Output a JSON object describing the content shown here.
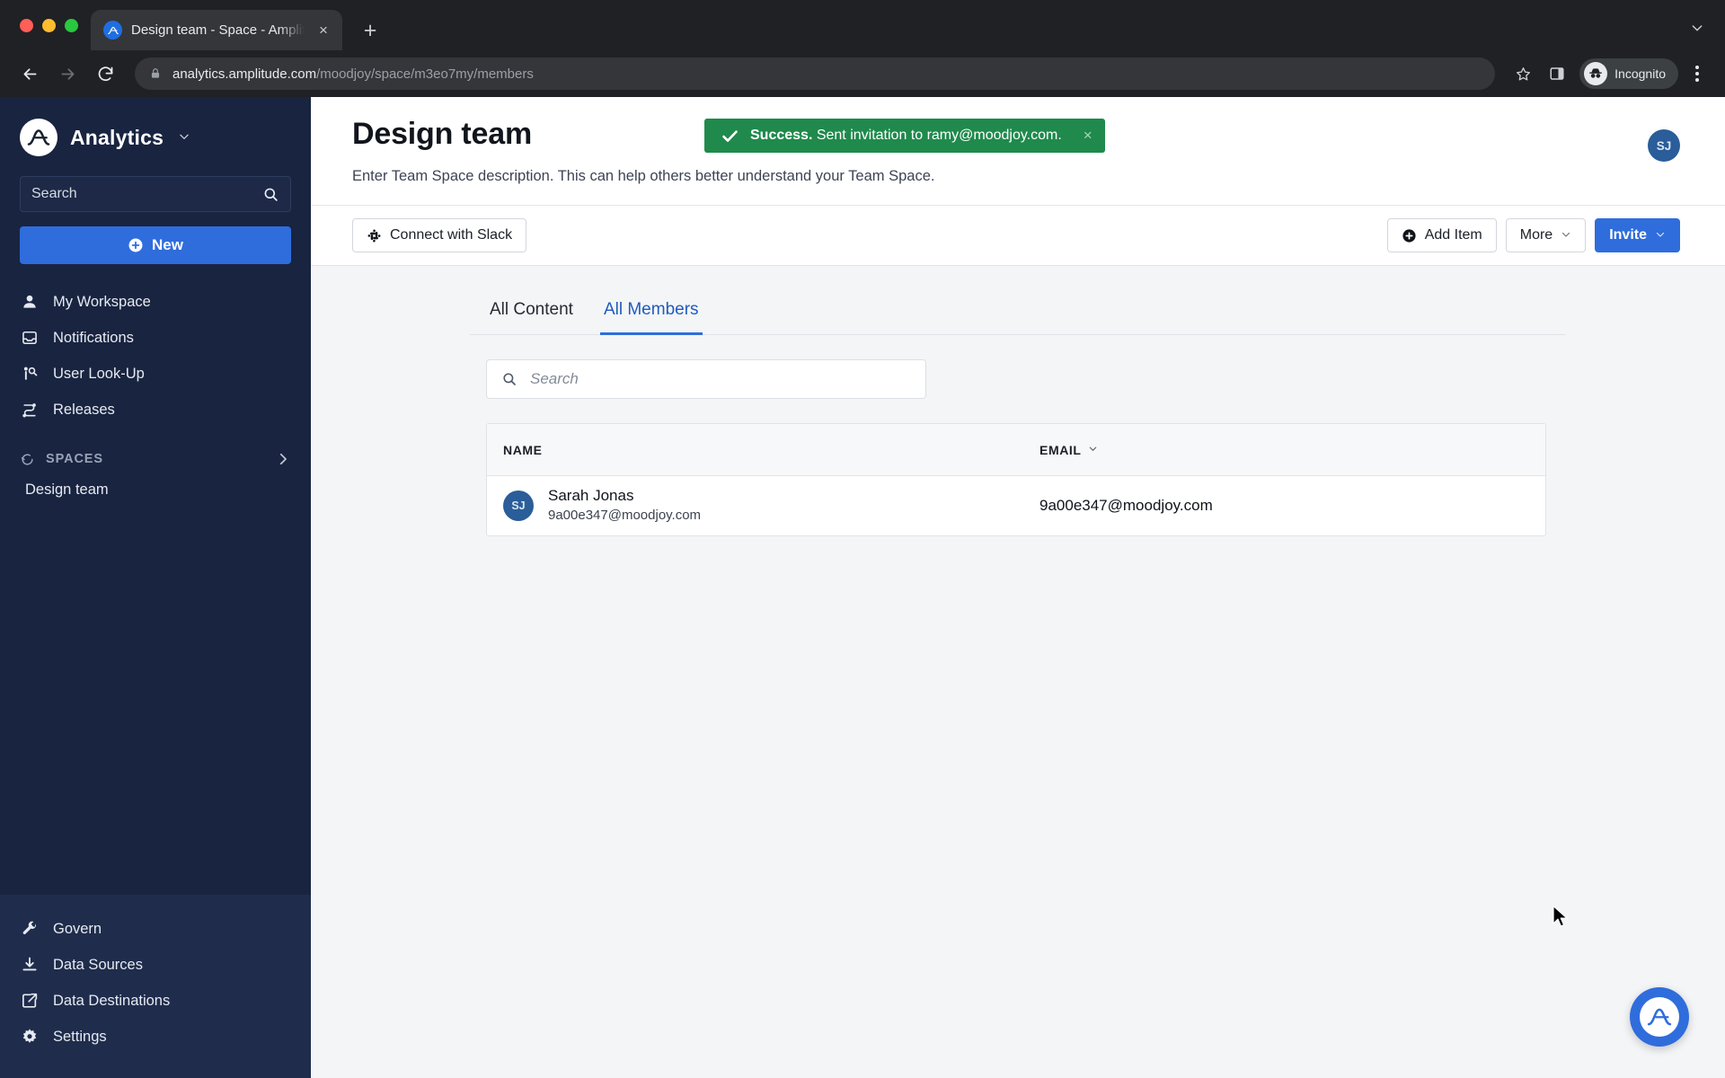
{
  "browser": {
    "tab": {
      "title": "Design team - Space - Amplitu",
      "favicon": "amplitude-icon",
      "close": "×"
    },
    "new_tab_label": "+",
    "url_host": "analytics.amplitude.com",
    "url_path": "/moodjoy/space/m3eo7my/members",
    "profile_label": "Incognito",
    "icons": {
      "back": "back-arrow-icon",
      "forward": "forward-arrow-icon",
      "reload": "reload-icon",
      "lock": "lock-icon",
      "bookmark": "star-icon",
      "sidepanel": "side-panel-icon",
      "menu": "kebab-menu-icon",
      "tablist": "chevron-down-icon"
    }
  },
  "sidebar": {
    "brand": {
      "name": "Analytics",
      "logo": "amplitude-logo-icon",
      "caret": "⌄"
    },
    "search": {
      "placeholder": "Search",
      "icon": "search-icon"
    },
    "new_button": {
      "label": "New",
      "icon": "plus-circle-icon"
    },
    "items": [
      {
        "label": "My Workspace",
        "icon": "person-icon"
      },
      {
        "label": "Notifications",
        "icon": "inbox-icon"
      },
      {
        "label": "User Look-Up",
        "icon": "user-search-icon"
      },
      {
        "label": "Releases",
        "icon": "releases-icon"
      }
    ],
    "spaces": {
      "label": "SPACES",
      "icon": "spaces-icon",
      "expand": "chevron-right-icon"
    },
    "space_items": [
      {
        "label": "Design team"
      }
    ],
    "bottom_items": [
      {
        "label": "Govern",
        "icon": "wrench-icon"
      },
      {
        "label": "Data Sources",
        "icon": "download-icon"
      },
      {
        "label": "Data Destinations",
        "icon": "share-out-icon"
      },
      {
        "label": "Settings",
        "icon": "gear-icon"
      }
    ]
  },
  "header": {
    "title": "Design team",
    "subtitle": "Enter Team Space description. This can help others better understand your Team Space.",
    "avatar": "SJ"
  },
  "toast": {
    "icon": "check-icon",
    "strong": "Success.",
    "message": " Sent invitation to ramy@moodjoy.com.",
    "close": "×",
    "color": "#1f8a4c"
  },
  "toolbar": {
    "slack_label": "Connect with Slack",
    "slack_icon": "slack-icon",
    "add_item_label": "Add Item",
    "add_item_icon": "plus-circle-icon",
    "more_label": "More",
    "more_caret": "⌄",
    "invite_label": "Invite",
    "invite_caret": "⌄",
    "accent": "#2f6ddc"
  },
  "main": {
    "tabs": [
      {
        "label": "All Content",
        "active": false
      },
      {
        "label": "All Members",
        "active": true
      }
    ],
    "search": {
      "placeholder": "Search",
      "icon": "search-icon"
    },
    "table": {
      "columns": [
        {
          "label": "NAME"
        },
        {
          "label": "EMAIL",
          "caret": "⌄"
        }
      ],
      "rows": [
        {
          "initials": "SJ",
          "name": "Sarah Jonas",
          "sub_email": "9a00e347@moodjoy.com",
          "email": "9a00e347@moodjoy.com"
        }
      ]
    }
  },
  "fab": {
    "icon": "amplitude-logo-icon"
  }
}
